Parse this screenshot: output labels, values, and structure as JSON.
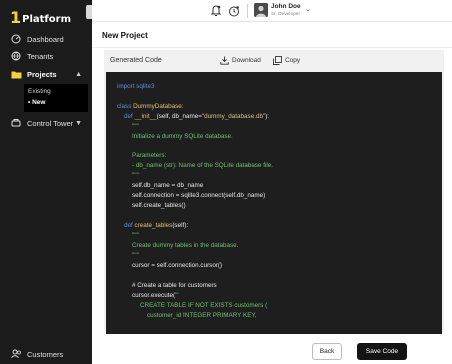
{
  "brand": {
    "mark": "1",
    "name": "Platform"
  },
  "sidebar": {
    "items": [
      {
        "label": "Dashboard"
      },
      {
        "label": "Tenants"
      },
      {
        "label": "Projects",
        "chevron": "▲"
      },
      {
        "label": "Control Tower",
        "chevron": "▼"
      },
      {
        "label": "Customers"
      }
    ],
    "project_subitems": [
      {
        "label": "Existing"
      },
      {
        "label": "• New"
      }
    ]
  },
  "topbar": {
    "user_name": "John Doe",
    "user_role": "Sr. Developer"
  },
  "page": {
    "title": "New Project"
  },
  "card": {
    "title": "Generated Code",
    "download_label": "Download",
    "copy_label": "Copy"
  },
  "code": {
    "l1": "import sqlite3",
    "l2_kw": "class ",
    "l2_name": "DummyDatabase:",
    "l3_kw": "def ",
    "l3_fn": "__init__",
    "l3_rest_a": "(self, db_name=",
    "l3_str": "\"dummy_database.db\"",
    "l3_rest_b": "):",
    "l4": "\"\"\"",
    "l5": "Initialize a dummy SQLite database.",
    "l6": "Parameters:",
    "l7": "- db_name (str): Name of the SQLite database file.",
    "l8": "\"\"\"",
    "l9": "self.db_name = db_name",
    "l10": "self.connection = sqlite3.connect(self.db_name)",
    "l11": "self.create_tables()",
    "l12_kw": "def ",
    "l12_fn": "create_tables",
    "l12_rest": "(self):",
    "l13": "\"\"\"",
    "l14": "Create dummy tables in the database.",
    "l15": "\"\"\"",
    "l16": "cursor = self.connection.cursor()",
    "l17": "# Create a table for customers",
    "l18_a": "cursor.execute(",
    "l18_b": "'''",
    "l19": "CREATE TABLE IF NOT EXISTS customers (",
    "l20": "customer_id INTEGER PRIMARY KEY,"
  },
  "footer": {
    "back_label": "Back",
    "save_label": "Save Code"
  },
  "colors": {
    "sidebar_bg": "#1b1b1b",
    "brand_accent": "#f2d23b",
    "code_bg": "#1e1e1e",
    "keyword": "#5c8fd6",
    "function": "#e5c16a",
    "docstring": "#6fc16f",
    "primary_button": "#141414"
  },
  "icons": {
    "dashboard": "dashboard-icon",
    "tenants": "tenants-icon",
    "projects": "folder-icon",
    "control_tower": "control-tower-icon",
    "customers": "customers-icon",
    "notifications": "bell-icon",
    "settings": "timer-icon",
    "download": "download-icon",
    "copy": "copy-icon"
  }
}
